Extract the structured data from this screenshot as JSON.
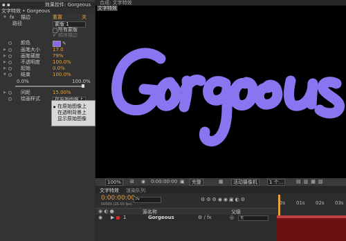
{
  "effects_panel": {
    "tab_label": "效果控件: Gorgeous",
    "header": "文字特效 • Gorgeous",
    "effect_name": "描边",
    "reset_label": "重置",
    "about_label": "关",
    "path_label": "路径",
    "path_value": "蒙版 1",
    "all_masks_label": "所有蒙版",
    "sequential_label": "顺序描边",
    "color_label": "颜色",
    "color_value": "#8866ee",
    "brush_size_label": "画笔大小",
    "brush_size_value": "17.0",
    "brush_hardness_label": "画笔硬度",
    "brush_hardness_value": "79%",
    "opacity_label": "不透明度",
    "opacity_value": "100.0%",
    "start_label": "起始",
    "start_value": "0.0%",
    "end_label": "结束",
    "end_value": "100.0%",
    "slider_min": "0.0%",
    "slider_max": "100.0%",
    "spacing_label": "间距",
    "spacing_value": "15.00%",
    "paint_style_label": "绘画样式",
    "paint_style_value": "在原始图像上"
  },
  "dropdown_menu": {
    "items": [
      "在原始图像上",
      "在透明背景上",
      "显示原始图像"
    ],
    "selected": 0
  },
  "viewer": {
    "tab_label": "合成: 文字特效",
    "sub_tab": "文字特效",
    "text": "Gorgeous",
    "text_color": "#8875f0",
    "toolbar": {
      "zoom": "100%",
      "timecode": "0:00:00:00",
      "quality": "完整",
      "camera": "活动摄像机",
      "view": "1 个..."
    }
  },
  "timeline": {
    "tabs": [
      "文字特效",
      "渲染队列"
    ],
    "timecode": "0:00:00:00",
    "fps": "00000 (25.00 fps)",
    "search_placeholder": "P▾",
    "layer_name_header": "源名称",
    "parent_header": "父级",
    "layer_index": "1",
    "layer_name": "Gorgeous",
    "parent_value": "无",
    "ticks": [
      "0s",
      "01s",
      "02s",
      "03s"
    ]
  }
}
